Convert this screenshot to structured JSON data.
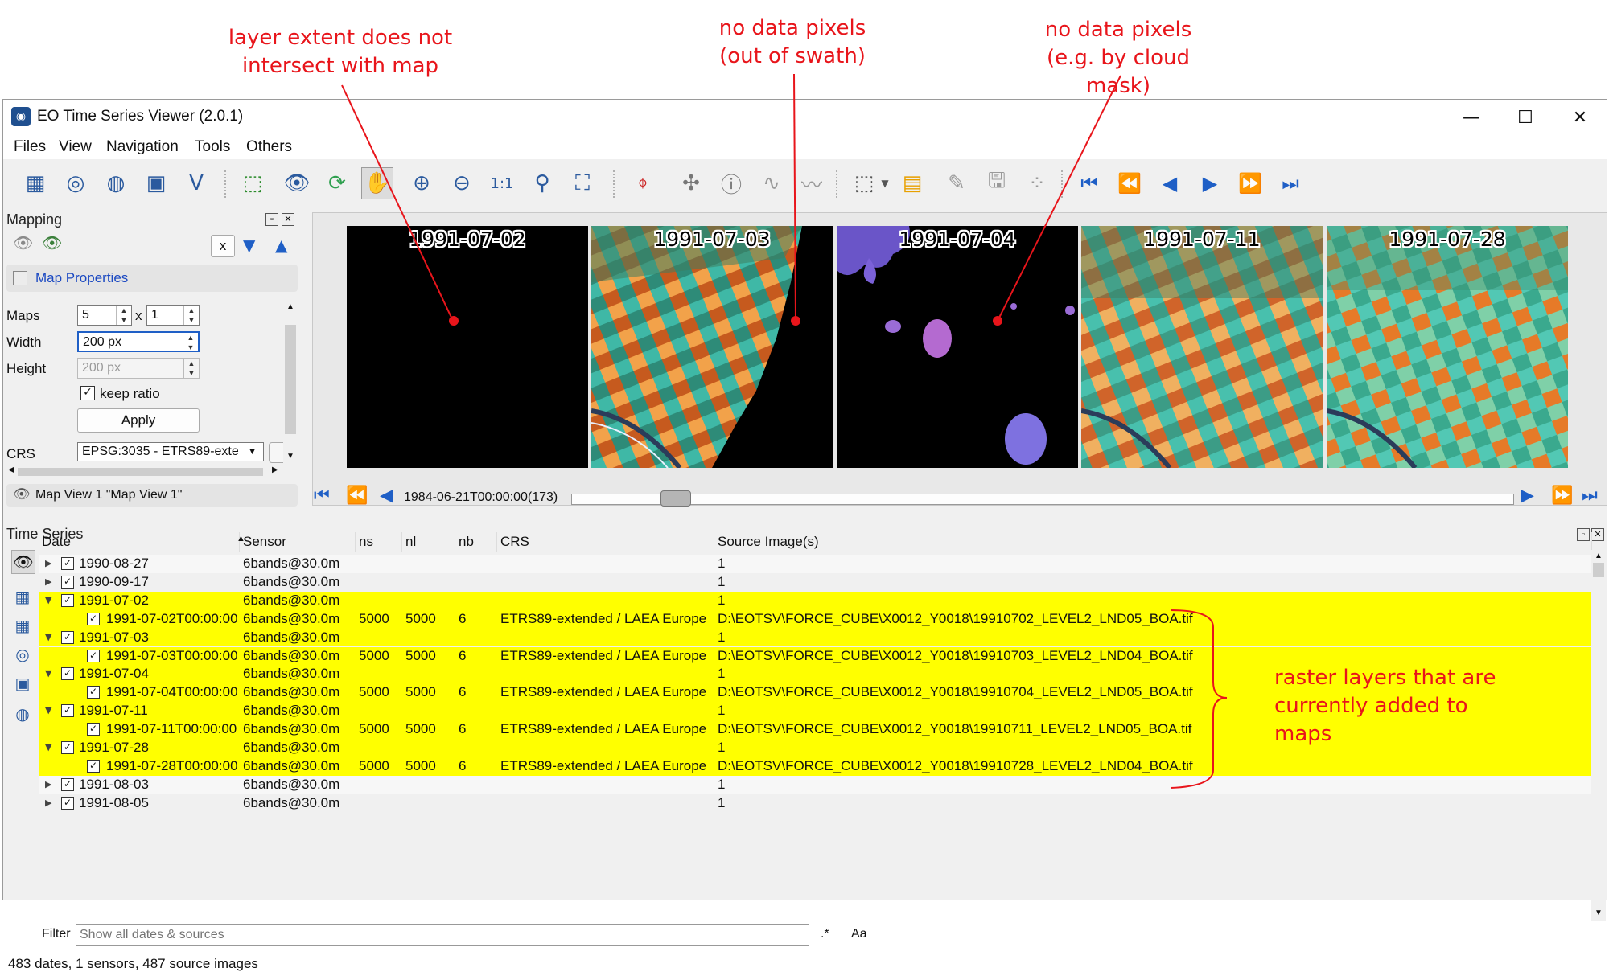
{
  "annotations": {
    "extent": [
      "layer extent does not",
      "intersect with map"
    ],
    "swath": [
      "no data pixels",
      "(out of swath)"
    ],
    "cloud": [
      "no data pixels",
      "(e.g. by cloud mask)"
    ],
    "raster": [
      "raster layers that are",
      "currently added to maps"
    ],
    "color": "#e8151b"
  },
  "window": {
    "title": "EO Time Series Viewer (2.0.1)",
    "controls": {
      "minimize": "—",
      "maximize": "☐",
      "close": "✕"
    }
  },
  "menu": [
    "Files",
    "View",
    "Navigation",
    "Tools",
    "Others"
  ],
  "mapping": {
    "title": "Mapping",
    "x_button": "x",
    "map_properties": "Map Properties",
    "maps_label": "Maps",
    "maps_value": "5",
    "maps_x": "x",
    "maps_value2": "1",
    "width_label": "Width",
    "width_value": "200 px",
    "height_label": "Height",
    "height_value": "200 px",
    "keep_ratio": "keep ratio",
    "apply": "Apply",
    "crs_label": "CRS",
    "crs_value": "EPSG:3035 - ETRS89-exte",
    "map_view": "Map View 1 \"Map View 1\""
  },
  "maps": [
    "1991-07-02",
    "1991-07-03",
    "1991-07-04",
    "1991-07-11",
    "1991-07-28"
  ],
  "time_slider": {
    "label": "1984-06-21T00:00:00(173)",
    "position": 0.11
  },
  "time_series": {
    "title": "Time Series",
    "headers": [
      "Date",
      "Sensor",
      "ns",
      "nl",
      "nb",
      "CRS",
      "Source Image(s)"
    ],
    "rows": [
      {
        "date": "1990-08-27",
        "sensor": "6bands@30.0m",
        "ns": "",
        "nl": "",
        "nb": "",
        "crs": "",
        "source": "1",
        "level": 0,
        "hl": false,
        "alt": true
      },
      {
        "date": "1990-09-17",
        "sensor": "6bands@30.0m",
        "ns": "",
        "nl": "",
        "nb": "",
        "crs": "",
        "source": "1",
        "level": 0,
        "hl": false,
        "alt": false
      },
      {
        "date": "1991-07-02",
        "sensor": "6bands@30.0m",
        "ns": "",
        "nl": "",
        "nb": "",
        "crs": "",
        "source": "1",
        "level": 0,
        "hl": true,
        "open": true
      },
      {
        "date": "1991-07-02T00:00:00",
        "sensor": "6bands@30.0m",
        "ns": "5000",
        "nl": "5000",
        "nb": "6",
        "crs": "ETRS89-extended / LAEA Europe",
        "source": "D:\\EOTSV\\FORCE_CUBE\\X0012_Y0018\\19910702_LEVEL2_LND05_BOA.tif",
        "level": 1,
        "hl": true
      },
      {
        "date": "1991-07-03",
        "sensor": "6bands@30.0m",
        "ns": "",
        "nl": "",
        "nb": "",
        "crs": "",
        "source": "1",
        "level": 0,
        "hl": true,
        "open": true
      },
      {
        "date": "1991-07-03T00:00:00",
        "sensor": "6bands@30.0m",
        "ns": "5000",
        "nl": "5000",
        "nb": "6",
        "crs": "ETRS89-extended / LAEA Europe",
        "source": "D:\\EOTSV\\FORCE_CUBE\\X0012_Y0018\\19910703_LEVEL2_LND04_BOA.tif",
        "level": 1,
        "hl": true
      },
      {
        "date": "1991-07-04",
        "sensor": "6bands@30.0m",
        "ns": "",
        "nl": "",
        "nb": "",
        "crs": "",
        "source": "1",
        "level": 0,
        "hl": true,
        "open": true
      },
      {
        "date": "1991-07-04T00:00:00",
        "sensor": "6bands@30.0m",
        "ns": "5000",
        "nl": "5000",
        "nb": "6",
        "crs": "ETRS89-extended / LAEA Europe",
        "source": "D:\\EOTSV\\FORCE_CUBE\\X0012_Y0018\\19910704_LEVEL2_LND05_BOA.tif",
        "level": 1,
        "hl": true
      },
      {
        "date": "1991-07-11",
        "sensor": "6bands@30.0m",
        "ns": "",
        "nl": "",
        "nb": "",
        "crs": "",
        "source": "1",
        "level": 0,
        "hl": true,
        "open": true
      },
      {
        "date": "1991-07-11T00:00:00",
        "sensor": "6bands@30.0m",
        "ns": "5000",
        "nl": "5000",
        "nb": "6",
        "crs": "ETRS89-extended / LAEA Europe",
        "source": "D:\\EOTSV\\FORCE_CUBE\\X0012_Y0018\\19910711_LEVEL2_LND05_BOA.tif",
        "level": 1,
        "hl": true
      },
      {
        "date": "1991-07-28",
        "sensor": "6bands@30.0m",
        "ns": "",
        "nl": "",
        "nb": "",
        "crs": "",
        "source": "1",
        "level": 0,
        "hl": true,
        "open": true
      },
      {
        "date": "1991-07-28T00:00:00",
        "sensor": "6bands@30.0m",
        "ns": "5000",
        "nl": "5000",
        "nb": "6",
        "crs": "ETRS89-extended / LAEA Europe",
        "source": "D:\\EOTSV\\FORCE_CUBE\\X0012_Y0018\\19910728_LEVEL2_LND04_BOA.tif",
        "level": 1,
        "hl": true
      },
      {
        "date": "1991-08-03",
        "sensor": "6bands@30.0m",
        "ns": "",
        "nl": "",
        "nb": "",
        "crs": "",
        "source": "1",
        "level": 0,
        "hl": false,
        "alt": true
      },
      {
        "date": "1991-08-05",
        "sensor": "6bands@30.0m",
        "ns": "",
        "nl": "",
        "nb": "",
        "crs": "",
        "source": "1",
        "level": 0,
        "hl": false,
        "alt": false
      }
    ],
    "filter_label": "Filter",
    "filter_placeholder": "Show all dates & sources",
    "regex_label": ".*",
    "case_label": "Aa",
    "status": "483 dates, 1 sensors, 487 source images"
  }
}
